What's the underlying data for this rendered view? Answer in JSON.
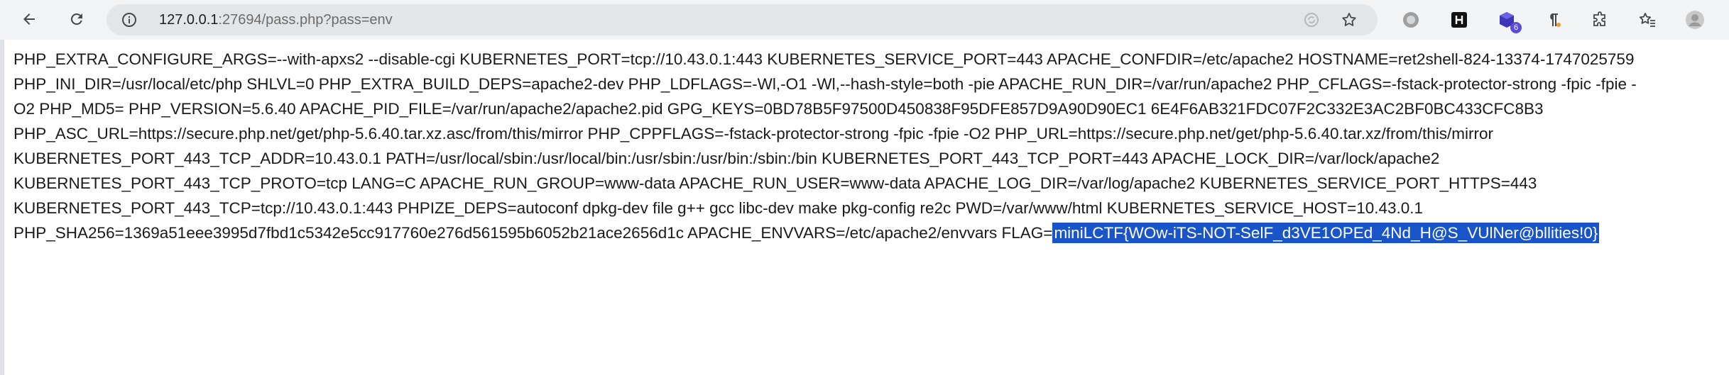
{
  "browser": {
    "url_host": "127.0.0.1",
    "url_rest": ":27694/pass.php?pass=env",
    "extension_badge": "6"
  },
  "icons": {
    "back": "arrow-left-icon",
    "reload": "reload-icon",
    "site_info": "info-circle-icon",
    "translate": "translate-icon",
    "bookmark": "star-icon",
    "extensions": "puzzle-icon",
    "bookmarks_panel": "star-list-icon",
    "profile": "avatar-icon"
  },
  "colors": {
    "selection": "#1a54c9",
    "toolbar": "#f1f3f4"
  },
  "page": {
    "lines": [
      "PHP_EXTRA_CONFIGURE_ARGS=--with-apxs2 --disable-cgi KUBERNETES_PORT=tcp://10.43.0.1:443 KUBERNETES_SERVICE_PORT=443 APACHE_CONFDIR=/etc/apache2 HOSTNAME=ret2shell-824-13374-1747025759",
      "PHP_INI_DIR=/usr/local/etc/php SHLVL=0 PHP_EXTRA_BUILD_DEPS=apache2-dev PHP_LDFLAGS=-Wl,-O1 -Wl,--hash-style=both -pie APACHE_RUN_DIR=/var/run/apache2 PHP_CFLAGS=-fstack-protector-strong -fpic -fpie -",
      "O2 PHP_MD5= PHP_VERSION=5.6.40 APACHE_PID_FILE=/var/run/apache2/apache2.pid GPG_KEYS=0BD78B5F97500D450838F95DFE857D9A90D90EC1 6E4F6AB321FDC07F2C332E3AC2BF0BC433CFC8B3",
      "PHP_ASC_URL=https://secure.php.net/get/php-5.6.40.tar.xz.asc/from/this/mirror PHP_CPPFLAGS=-fstack-protector-strong -fpic -fpie -O2 PHP_URL=https://secure.php.net/get/php-5.6.40.tar.xz/from/this/mirror",
      "KUBERNETES_PORT_443_TCP_ADDR=10.43.0.1 PATH=/usr/local/sbin:/usr/local/bin:/usr/sbin:/usr/bin:/sbin:/bin KUBERNETES_PORT_443_TCP_PORT=443 APACHE_LOCK_DIR=/var/lock/apache2",
      "KUBERNETES_PORT_443_TCP_PROTO=tcp LANG=C APACHE_RUN_GROUP=www-data APACHE_RUN_USER=www-data APACHE_LOG_DIR=/var/log/apache2 KUBERNETES_SERVICE_PORT_HTTPS=443",
      "KUBERNETES_PORT_443_TCP=tcp://10.43.0.1:443 PHPIZE_DEPS=autoconf dpkg-dev file g++ gcc libc-dev make pkg-config re2c PWD=/var/www/html KUBERNETES_SERVICE_HOST=10.43.0.1"
    ],
    "last_line_prefix": "PHP_SHA256=1369a51eee3995d7fbd1c5342e5cc917760e276d561595b6052b21ace2656d1c APACHE_ENVVARS=/etc/apache2/envvars FLAG=",
    "flag_value": "miniLCTF{WOw-iTS-NOT-SelF_d3VE1OPEd_4Nd_H@S_VUlNer@bllities!0}"
  }
}
